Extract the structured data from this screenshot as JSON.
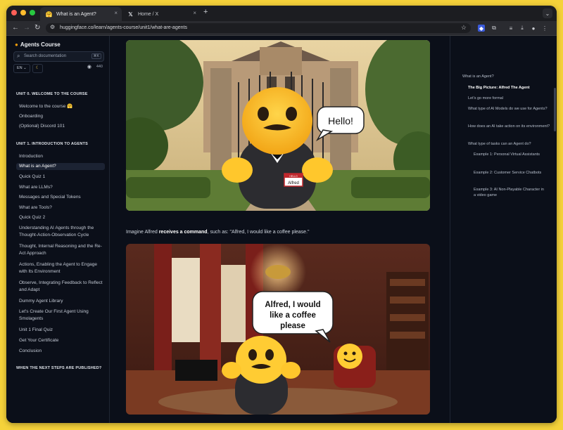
{
  "browser": {
    "tabs": [
      {
        "title": "What is an Agent?",
        "icon": "hugging-face-emoji-icon"
      },
      {
        "title": "Home / X",
        "icon": "x-logo-icon"
      }
    ],
    "new_tab": "+",
    "tab_close": "×",
    "url": "huggingface.co/learn/agents-course/unit1/what-are-agents",
    "traffic_colors": [
      "#ff5f57",
      "#febc2e",
      "#28c840"
    ]
  },
  "sidebar": {
    "brand": "Agents Course",
    "search_placeholder": "Search documentation",
    "search_shortcut": "⌘K",
    "language": "EN",
    "github_stars": "440",
    "unit0_title": "UNIT 0. WELCOME TO THE COURSE",
    "unit0_items": [
      "Welcome to the course 🤗",
      "Onboarding",
      "(Optional) Discord 101"
    ],
    "unit1_title": "UNIT 1. INTRODUCTION TO AGENTS",
    "unit1_items": [
      "Introduction",
      "What is an Agent?",
      "Quick Quiz 1",
      "What are LLMs?",
      "Messages and Special Tokens",
      "What are Tools?",
      "Quick Quiz 2",
      "Understanding AI Agents through the Thought-Action-Observation Cycle",
      "Thought, Internal Reasoning and the Re-Act Approach",
      "Actions, Enabling the Agent to Engage with Its Environment",
      "Observe, Integrating Feedback to Reflect and Adapt",
      "Dummy Agent Library",
      "Let's Create Our First Agent Using Smolagents",
      "Unit 1 Final Quiz",
      "Get Your Certificate",
      "Conclusion"
    ],
    "next_title": "WHEN THE NEXT STEPS ARE PUBLISHED?"
  },
  "main": {
    "image1": {
      "speech": "Hello!",
      "badge_top": "HELLO",
      "badge_name": "Alfred"
    },
    "caption_pre": "Imagine Alfred ",
    "caption_bold": "receives a command",
    "caption_post": ", such as: \"Alfred, I would like a coffee please.\"",
    "image2": {
      "speech_lines": [
        "Alfred, I would",
        "like a coffee",
        "please"
      ]
    }
  },
  "toc": [
    "What is an Agent?",
    "The Big Picture: Alfred The Agent",
    "Let's go more formal",
    "What type of AI Models do we use for Agents?",
    "How does an AI take action on its environment?",
    "What type of tasks can an Agent do?",
    "Example 1: Personal Virtual Assistants",
    "Example 2: Customer Service Chatbots",
    "Example 3: AI Non-Playable Character in a video game"
  ]
}
